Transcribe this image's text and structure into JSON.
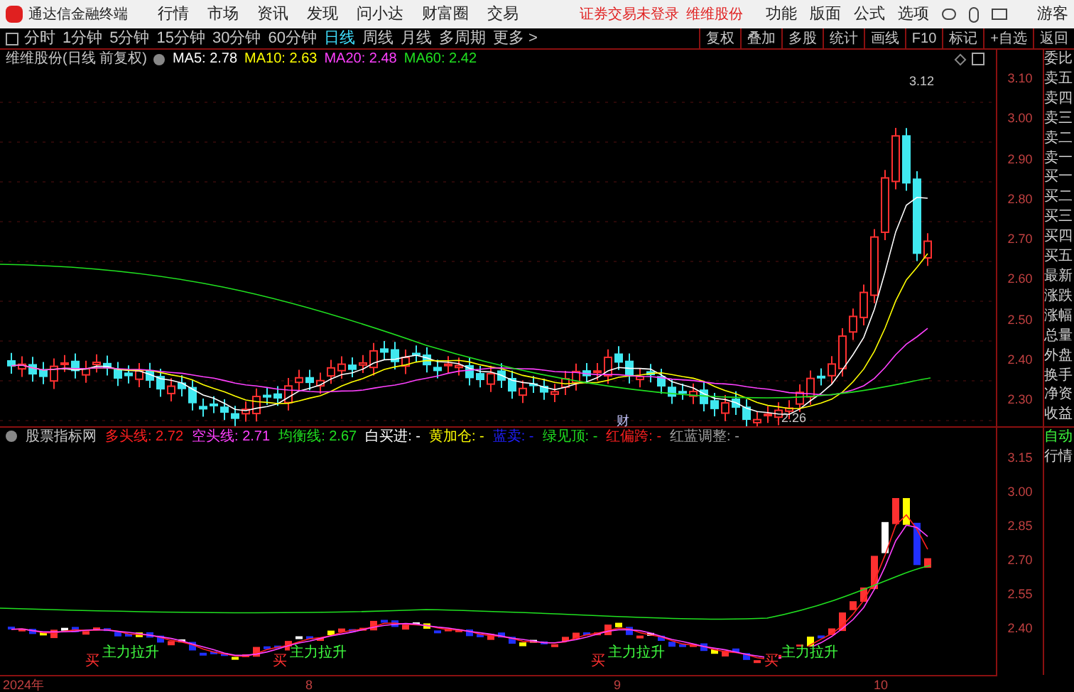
{
  "app": {
    "title": "通达信金融终端",
    "menu": [
      "行情",
      "市场",
      "资讯",
      "发现",
      "问小达",
      "财富圈",
      "交易"
    ],
    "notice": "证券交易未登录",
    "stock_link": "维维股份",
    "tools": [
      "功能",
      "版面",
      "公式",
      "选项"
    ],
    "user": "游客"
  },
  "periods": [
    {
      "label": "分时",
      "selected": false
    },
    {
      "label": "1分钟",
      "selected": false
    },
    {
      "label": "5分钟",
      "selected": false
    },
    {
      "label": "15分钟",
      "selected": false
    },
    {
      "label": "30分钟",
      "selected": false
    },
    {
      "label": "60分钟",
      "selected": false
    },
    {
      "label": "日线",
      "selected": true
    },
    {
      "label": "周线",
      "selected": false
    },
    {
      "label": "月线",
      "selected": false
    },
    {
      "label": "多周期",
      "selected": false
    },
    {
      "label": "更多 >",
      "selected": false
    }
  ],
  "actions": [
    "复权",
    "叠加",
    "多股",
    "统计",
    "画线",
    "F10",
    "标记",
    "+自选",
    "返回"
  ],
  "main_chart": {
    "title": "维维股份(日线 前复权)",
    "legend": [
      {
        "label": "MA5: 2.78",
        "color": "#ffffff"
      },
      {
        "label": "MA10: 2.63",
        "color": "#ffff00"
      },
      {
        "label": "MA20: 2.48",
        "color": "#ff40ff"
      },
      {
        "label": "MA60: 2.42",
        "color": "#20e020"
      }
    ],
    "high_label": "3.12",
    "low_label": "2.26",
    "event_mark": "财",
    "yticks": [
      "3.10",
      "3.00",
      "2.90",
      "2.80",
      "2.70",
      "2.60",
      "2.50",
      "2.40",
      "2.30"
    ]
  },
  "indicator": {
    "title": "股票指标网",
    "legend": [
      {
        "label": "多头线: 2.72",
        "color": "#ff2020"
      },
      {
        "label": "空头线: 2.71",
        "color": "#ff40ff"
      },
      {
        "label": "均衡线: 2.67",
        "color": "#20e020"
      },
      {
        "label": "白买进: -",
        "color": "#ffffff"
      },
      {
        "label": "黄加仓: -",
        "color": "#ffff00"
      },
      {
        "label": "蓝卖: -",
        "color": "#2020ff"
      },
      {
        "label": "绿见顶: -",
        "color": "#20e020"
      },
      {
        "label": "红偏跨: -",
        "color": "#ff2020"
      },
      {
        "label": "红蓝调整: -",
        "color": "#a0a0a0"
      }
    ],
    "signals": [
      {
        "buy": "买",
        "tag": "主力拉升"
      },
      {
        "buy": "买",
        "tag": "主力拉升"
      },
      {
        "buy": "买",
        "tag": "主力拉升"
      },
      {
        "buy": "买",
        "tag": "主力拉升"
      }
    ],
    "yticks": [
      "3.15",
      "3.00",
      "2.85",
      "2.70",
      "2.55",
      "2.40"
    ]
  },
  "time_axis": [
    "2024年",
    "8",
    "9",
    "10"
  ],
  "quote_panel": {
    "rows": [
      "委比",
      "卖五",
      "卖四",
      "卖三",
      "卖二",
      "卖一",
      "买一",
      "买二",
      "买三",
      "买四",
      "买五",
      "最新",
      "涨跌",
      "涨幅",
      "总量",
      "外盘",
      "换手",
      "净资",
      "收益"
    ],
    "lower_rows": [
      "自动",
      "行情"
    ]
  }
}
